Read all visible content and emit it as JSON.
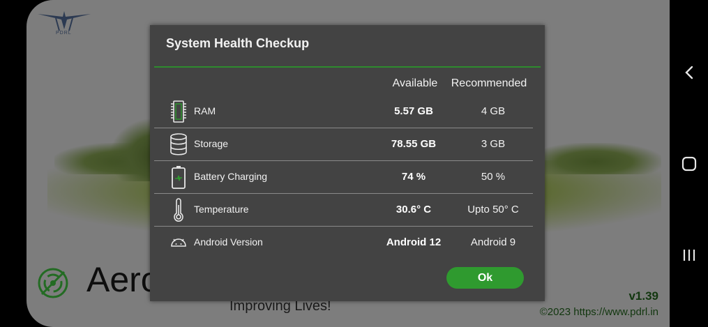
{
  "app": {
    "logo_text": "PDRL",
    "brand_text": "Aero",
    "tagline": "Improving Lives!",
    "version": "v1.39",
    "copyright": "©2023  https://www.pdrl.in"
  },
  "dialog": {
    "title": "System Health Checkup",
    "headers": {
      "available": "Available",
      "recommended": "Recommended"
    },
    "rows": [
      {
        "icon": "ram-chip-icon",
        "label": "RAM",
        "available": "5.57 GB",
        "recommended": "4 GB"
      },
      {
        "icon": "storage-database-icon",
        "label": "Storage",
        "available": "78.55 GB",
        "recommended": "3 GB"
      },
      {
        "icon": "battery-charging-icon",
        "label": "Battery Charging",
        "available": "74 %",
        "recommended": "50 %"
      },
      {
        "icon": "thermometer-icon",
        "label": "Temperature",
        "available": "30.6° C",
        "recommended": "Upto 50° C"
      },
      {
        "icon": "android-icon",
        "label": "Android Version",
        "available": "Android 12",
        "recommended": "Android 9"
      }
    ],
    "ok_label": "Ok"
  },
  "colors": {
    "accent": "#2f9a2f",
    "dialog_bg": "#434343",
    "divider": "#2e8b2e"
  }
}
